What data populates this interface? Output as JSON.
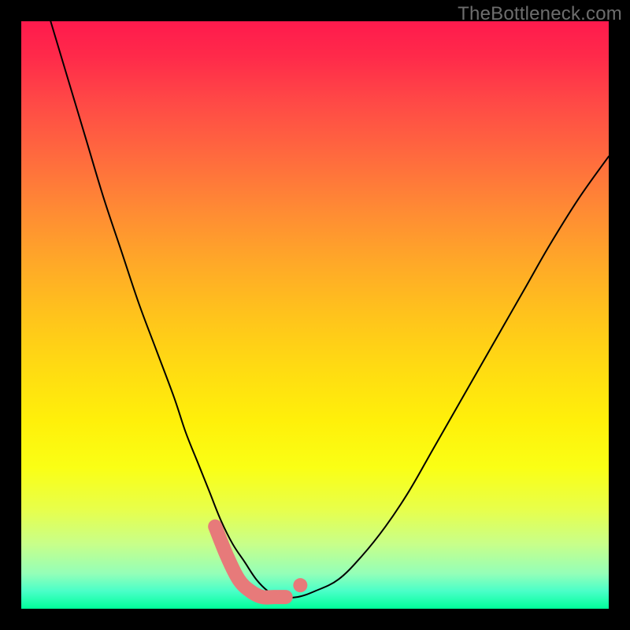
{
  "watermark": "TheBottleneck.com",
  "colors": {
    "gradient_top": "#ff1a4d",
    "gradient_mid": "#ffeb00",
    "gradient_bottom": "#00ff9a",
    "curve": "#000000",
    "highlight": "#e77a7a",
    "frame": "#000000"
  },
  "chart_data": {
    "type": "line",
    "title": "",
    "xlabel": "",
    "ylabel": "",
    "xlim": [
      0,
      100
    ],
    "ylim": [
      0,
      100
    ],
    "grid": false,
    "legend": false,
    "annotations": [
      "TheBottleneck.com"
    ],
    "series": [
      {
        "name": "bottleneck-curve",
        "x": [
          5,
          8,
          11,
          14,
          17,
          20,
          23,
          26,
          28,
          30,
          32,
          34,
          36,
          38,
          40,
          42,
          44,
          47,
          50,
          54,
          58,
          62,
          66,
          70,
          74,
          78,
          82,
          86,
          90,
          95,
          100
        ],
        "y": [
          100,
          90,
          80,
          70,
          61,
          52,
          44,
          36,
          30,
          25,
          20,
          15,
          11,
          8,
          5,
          3,
          2,
          2,
          3,
          5,
          9,
          14,
          20,
          27,
          34,
          41,
          48,
          55,
          62,
          70,
          77
        ]
      }
    ],
    "highlight_segment": {
      "name": "trough-highlight",
      "x": [
        33,
        35,
        37,
        39,
        41,
        43,
        45
      ],
      "y": [
        14,
        9,
        5,
        3,
        2,
        2,
        2
      ]
    },
    "highlight_point": {
      "x": 47.5,
      "y": 4
    }
  }
}
